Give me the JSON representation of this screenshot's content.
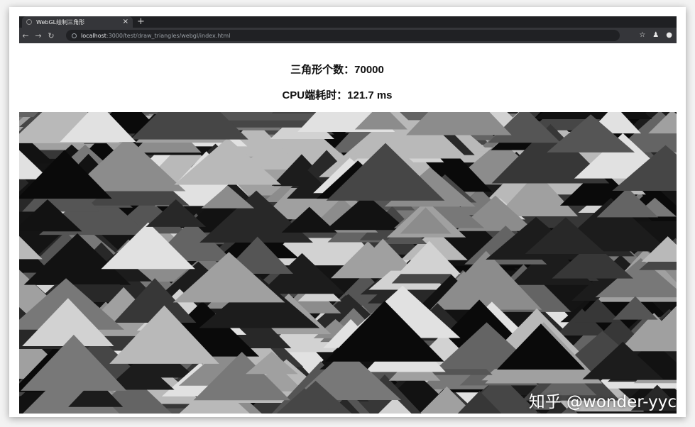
{
  "browser": {
    "tab_title": "WebGL绘制三角形",
    "tab_close": "×",
    "new_tab": "+",
    "url_host": "localhost",
    "url_rest": ":3000/test/draw_triangles/webgl/index.html"
  },
  "page": {
    "triangle_count_text": "三角形个数：70000",
    "cpu_time_text": "CPU端耗时：121.7 ms"
  },
  "watermark": "知乎 @wonder-yyc",
  "icons": [
    "back-arrow-icon",
    "forward-arrow-icon",
    "reload-icon",
    "info-icon",
    "star-icon",
    "extension-icon",
    "profile-icon"
  ]
}
